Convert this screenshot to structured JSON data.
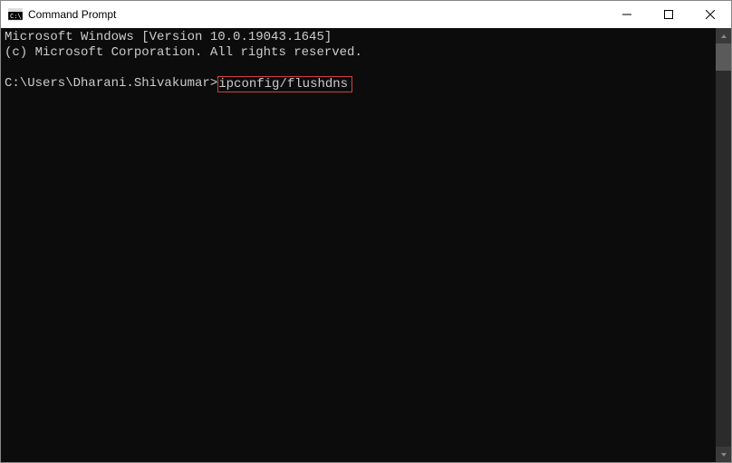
{
  "titlebar": {
    "title": "Command Prompt"
  },
  "terminal": {
    "line1": "Microsoft Windows [Version 10.0.19043.1645]",
    "line2": "(c) Microsoft Corporation. All rights reserved.",
    "blank": "",
    "prompt": "C:\\Users\\Dharani.Shivakumar>",
    "command": "ipconfig/flushdns"
  }
}
